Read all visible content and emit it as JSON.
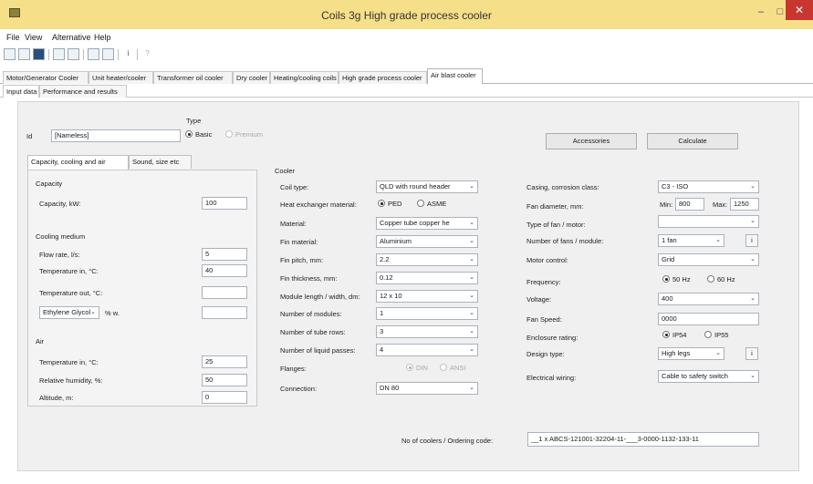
{
  "window": {
    "title": "Coils 3g High grade process cooler",
    "minimize_glyph": "–",
    "maximize_glyph": "□",
    "close_glyph": "✕"
  },
  "menu": [
    {
      "label": "File"
    },
    {
      "label": "View"
    },
    {
      "label": "Alternative"
    },
    {
      "label": "Help"
    }
  ],
  "toolbar_icons": [
    "new-icon",
    "open-icon",
    "save-icon",
    "print-icon",
    "preview-icon",
    "copy-icon",
    "paste-icon",
    "info-icon",
    "help-icon"
  ],
  "toolbar": {
    "info_glyph": "i",
    "help_glyph": "?"
  },
  "product_tabs": [
    {
      "label": "Motor/Generator Cooler"
    },
    {
      "label": "Unit heater/cooler"
    },
    {
      "label": "Transformer oil cooler"
    },
    {
      "label": "Dry cooler"
    },
    {
      "label": "Heating/cooling coils"
    },
    {
      "label": "High grade process cooler"
    },
    {
      "label": "Air blast cooler"
    }
  ],
  "sub_tabs": [
    {
      "label": "Input data"
    },
    {
      "label": "Performance and results"
    }
  ],
  "general": {
    "id_label": "Id",
    "id_value": "[Nameless]",
    "type_label": "Type",
    "type_basic": "Basic",
    "type_premium": "Premium",
    "accessories_button": "Accessories",
    "calculate_button": "Calculate"
  },
  "left_tabs": [
    {
      "label": "Capacity, cooling and air"
    },
    {
      "label": "Sound, size etc"
    }
  ],
  "capacity": {
    "section": "Capacity",
    "capacity_label": "Capacity, kW:",
    "capacity_value": "100"
  },
  "cooling_medium": {
    "section": "Cooling medium",
    "flow_label": "Flow rate, l/s:",
    "flow_value": "5",
    "temp_in_label": "Temperature in, °C:",
    "temp_in_value": "40",
    "temp_out_label": "Temperature out, °C:",
    "temp_out_value": "",
    "medium_value": "Ethylene Glycol",
    "medium_unit": "% w.",
    "medium_percent": ""
  },
  "air": {
    "section": "Air",
    "temp_in_label": "Temperature in, °C:",
    "temp_in_value": "25",
    "humidity_label": "Relative humidity, %:",
    "humidity_value": "50",
    "altitude_label": "Altitude, m:",
    "altitude_value": "0"
  },
  "cooler": {
    "section": "Cooler",
    "coil_type_label": "Coil type:",
    "coil_type_value": "QLD with round header",
    "heat_exchanger_label": "Heat exchanger material:",
    "ped_label": "PED",
    "asme_label": "ASME",
    "material_label": "Material:",
    "material_value": "Copper tube copper he",
    "fin_material_label": "Fin material:",
    "fin_material_value": "Aluminium",
    "fin_pitch_label": "Fin pitch, mm:",
    "fin_pitch_value": "2.2",
    "fin_thickness_label": "Fin thickness, mm:",
    "fin_thickness_value": "0.12",
    "module_label": "Module length / width, dm:",
    "module_value": "12 x 10",
    "modules_label": "Number of modules:",
    "modules_value": "1",
    "tube_rows_label": "Number of tube rows:",
    "tube_rows_value": "3",
    "passes_label": "Number of liquid passes:",
    "passes_value": "4",
    "flanges_label": "Flanges:",
    "flange_din": "DIN",
    "flange_ansi": "ANSI",
    "connection_label": "Connection:",
    "connection_value": "DN 80"
  },
  "casing": {
    "casing_label": "Casing, corrosion class:",
    "casing_value": "C3 - ISO",
    "fan_diameter_label": "Fan diameter, mm:",
    "fan_min_label": "Min:",
    "fan_min_value": "800",
    "fan_max_label": "Max:",
    "fan_max_value": "1250",
    "fan_type_label": "Type of fan / motor:",
    "fan_type_value": "",
    "fans_label": "Number of fans / module:",
    "fans_value": "1 fan",
    "motor_control_label": "Motor control:",
    "motor_control_value": "Grid",
    "frequency_label": "Frequency:",
    "freq_50": "50 Hz",
    "freq_60": "60 Hz",
    "voltage_label": "Voltage:",
    "voltage_value": "400",
    "fan_speed_label": "Fan Speed:",
    "fan_speed_value": "0000",
    "enclosure_label": "Enclosure rating:",
    "ip54": "IP54",
    "ip55": "IP55",
    "design_label": "Design type:",
    "design_value": "High legs",
    "wiring_label": "Electrical wiring:",
    "wiring_value": "Cable to safety switch",
    "info_glyph": "i"
  },
  "ordering": {
    "label": "No of coolers / Ordering code:",
    "value": "__1 x ABCS-121001-32204-11-___3-0000-1132-133-11"
  },
  "colors": {
    "titlebar": "#f6df89",
    "close": "#c7372f",
    "panel": "#f0f0f0"
  }
}
